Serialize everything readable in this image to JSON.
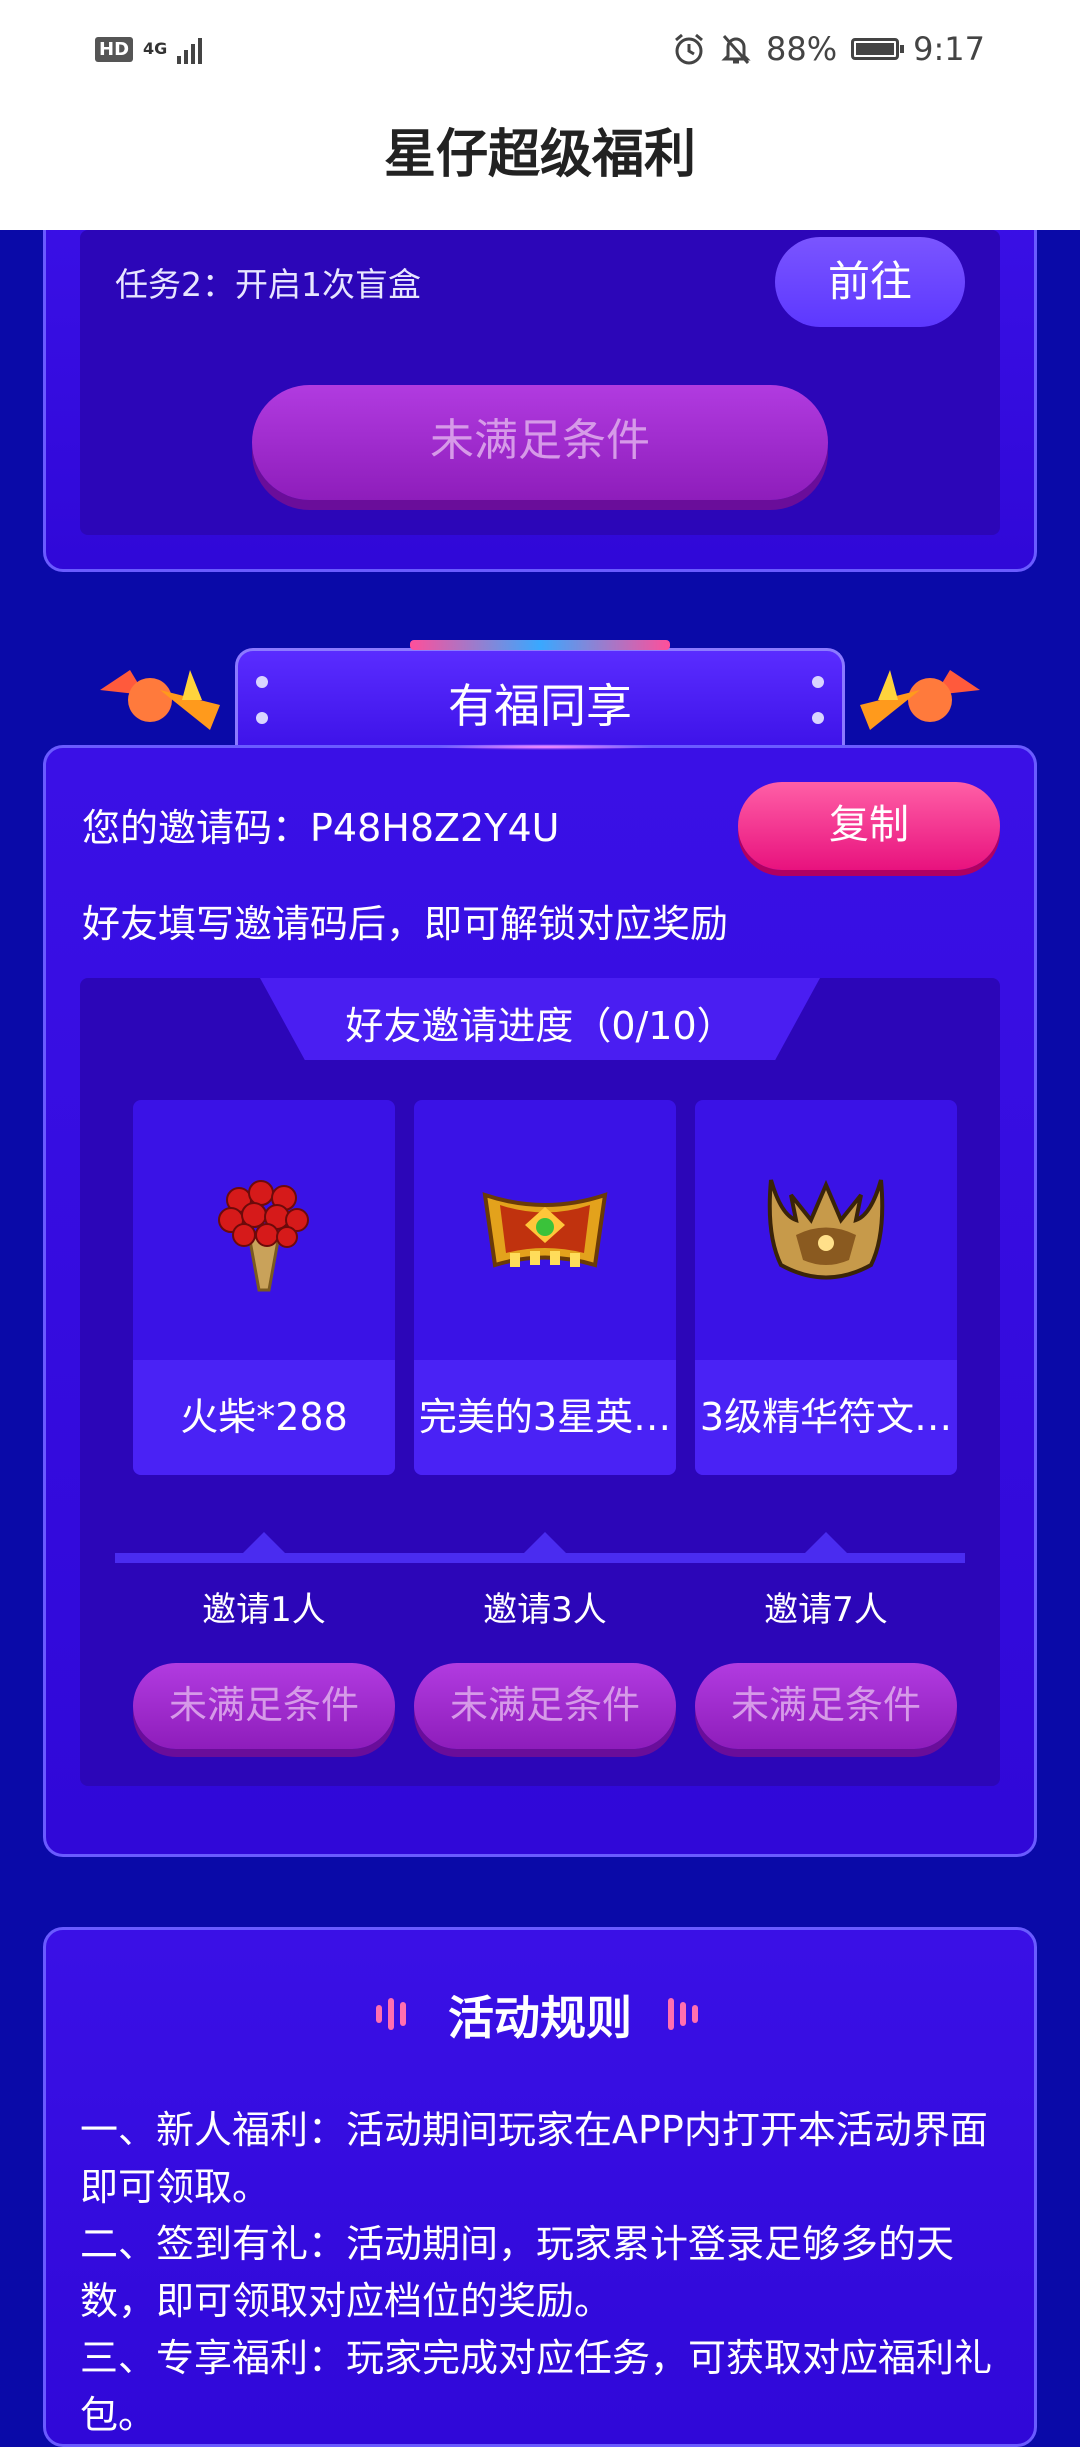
{
  "status_bar": {
    "network": "4G",
    "hd": "HD",
    "battery": "88%",
    "battery_level": 0.88,
    "time": "9:17"
  },
  "header": {
    "title": "星仔超级福利"
  },
  "task_section": {
    "task_text": "任务2：开启1次盲盒",
    "goto_label": "前往",
    "claim_label": "未满足条件"
  },
  "share_section": {
    "title": "有福同享",
    "invite_label": "您的邀请码：P48H8Z2Y4U",
    "copy_label": "复制",
    "hint": "好友填写邀请码后，即可解锁对应奖励",
    "progress_title": "好友邀请进度（0/10）",
    "rewards": [
      {
        "name": "火柴*288",
        "requirement": "邀请1人",
        "status": "未满足条件",
        "icon": "bouquet-icon"
      },
      {
        "name": "完美的3星英…",
        "requirement": "邀请3人",
        "status": "未满足条件",
        "icon": "chest-icon"
      },
      {
        "name": "3级精华符文…",
        "requirement": "邀请7人",
        "status": "未满足条件",
        "icon": "crown-icon"
      }
    ]
  },
  "rules_section": {
    "title": "活动规则",
    "lines": [
      "一、新人福利：活动期间玩家在APP内打开本活动界面即可领取。",
      "二、签到有礼：活动期间，玩家累计登录足够多的天数，即可领取对应档位的奖励。",
      "三、专享福利：玩家完成对应任务，可获取对应福利礼包。"
    ]
  },
  "colors": {
    "background": "#0a0aa8",
    "panel": "#3a10e6",
    "accent_pink": "#e8127e",
    "disabled_purple": "#9e2ccc"
  }
}
